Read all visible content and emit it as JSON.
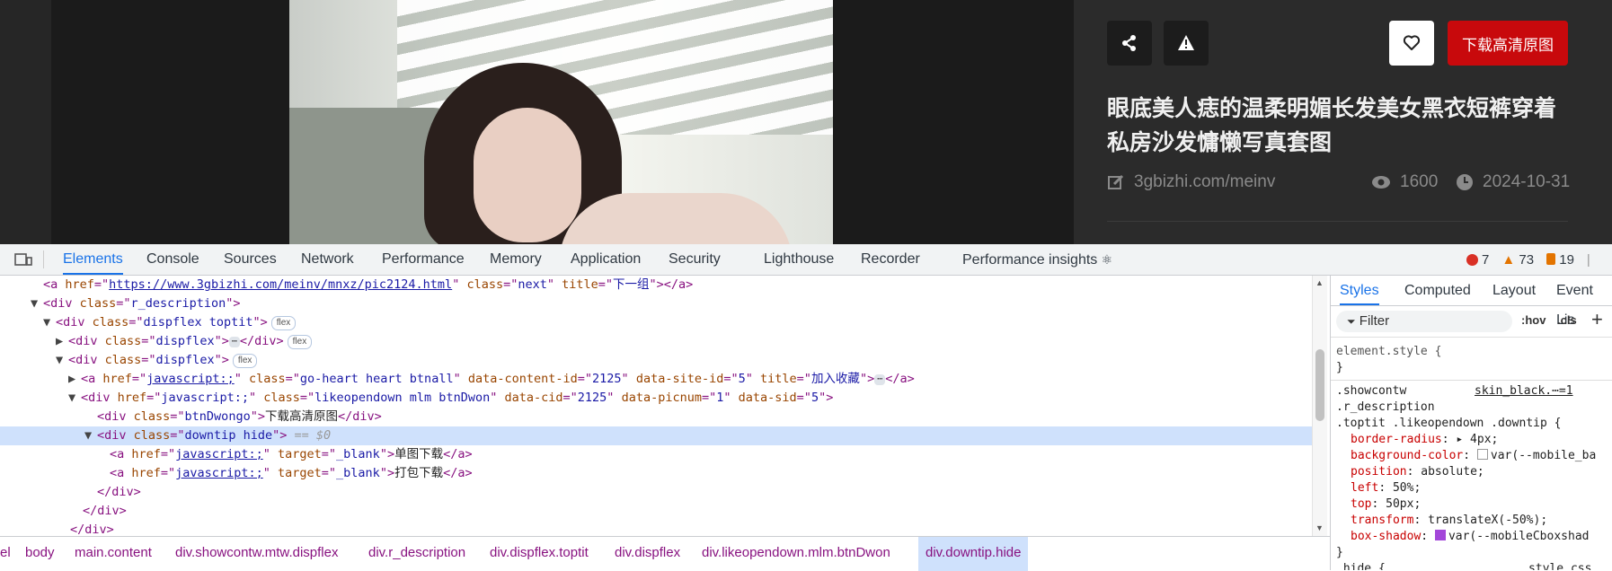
{
  "page": {
    "title": "眼底美人痣的温柔明媚长发美女黑衣短裤穿着私房沙发慵懒写真套图",
    "download_label": "下载高清原图",
    "source": "3gbizhi.com/meinv",
    "views": "1600",
    "date": "2024-10-31",
    "icons": [
      "share-icon",
      "warning-icon",
      "heart-icon",
      "edit-icon",
      "eye-icon",
      "clock-icon"
    ]
  },
  "devtools": {
    "tabs": [
      "Elements",
      "Console",
      "Sources",
      "Network",
      "Performance",
      "Memory",
      "Application",
      "Security",
      "Lighthouse",
      "Recorder",
      "Performance insights"
    ],
    "active_tab": "Elements",
    "error_count": "7",
    "warning_count": "73",
    "issue_count": "19",
    "dom": {
      "l0_href": "https://www.3gbizhi.com/meinv/mnxz/pic2124.html",
      "l0_class": "next",
      "l0_title": "下一组",
      "l1_class": "r_description",
      "l2_class": "dispflex toptit",
      "l3_class": "dispflex",
      "l4_class": "dispflex",
      "l5_href": "javascript:;",
      "l5_class": "go-heart heart btnall",
      "l5_cid": "2125",
      "l5_sid": "5",
      "l5_title": "加入收藏",
      "l6_href": "javascript:;",
      "l6_class": "likeopendown mlm btnDwon",
      "l6_cid": "2125",
      "l6_picnum": "1",
      "l6_sid": "5",
      "l7_class": "btnDwongo",
      "l7_text": "下载高清原图",
      "l8_class": "downtip hide",
      "l8_eq": "== $0",
      "l9_href": "javascript:;",
      "l9_target": "_blank",
      "l9_text": "单图下载",
      "l10_href": "javascript:;",
      "l10_target": "_blank",
      "l10_text": "打包下载",
      "badge_flex": "flex"
    },
    "breadcrumbs": [
      "el",
      "body",
      "main.content",
      "div.showcontw.mtw.dispflex",
      "div.r_description",
      "div.dispflex.toptit",
      "div.dispflex",
      "div.likeopendown.mlm.btnDwon",
      "div.downtip.hide"
    ],
    "styles_tabs": [
      "Styles",
      "Computed",
      "Layout",
      "Event Lis"
    ],
    "filter_placeholder": "Filter",
    "hov": ":hov",
    "cls": ".cls",
    "plus": "+",
    "element_style": "element.style {",
    "close_brace": "}",
    "selector1": ".showcontw",
    "selector2": ".r_description",
    "selector3": ".toptit .likeopendown .downtip {",
    "source_file": "skin_black.⋯=1",
    "props": [
      {
        "name": "border-radius",
        "value": "▸ 4px;"
      },
      {
        "name": "background-color",
        "value": "var(--mobile_ba"
      },
      {
        "name": "position",
        "value": "absolute;"
      },
      {
        "name": "left",
        "value": "50%;"
      },
      {
        "name": "top",
        "value": "50px;"
      },
      {
        "name": "transform",
        "value": "translateX(-50%);"
      },
      {
        "name": "box-shadow",
        "value": "var(--mobileCboxshad"
      }
    ],
    "next_rule": ".hide {",
    "next_source": "style.css"
  }
}
